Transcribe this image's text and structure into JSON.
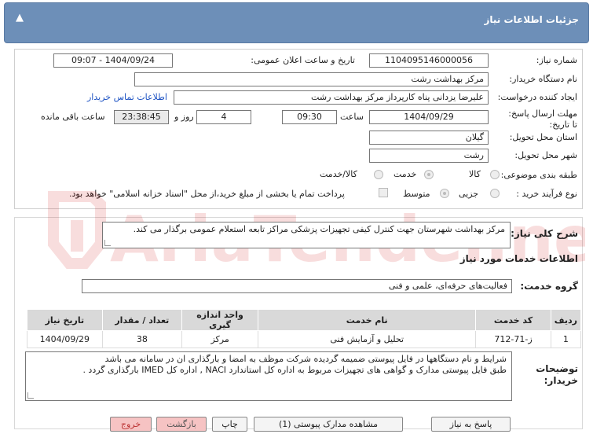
{
  "header": {
    "title": "جزئیات اطلاعات نیاز"
  },
  "form": {
    "need_number_label": "شماره نیاز:",
    "need_number": "1104095146000056",
    "announce_label": "تاریخ و ساعت اعلان عمومی:",
    "announce_value": "1404/09/24 - 09:07",
    "buyer_label": "نام دستگاه خریدار:",
    "buyer_value": "مرکز بهداشت رشت",
    "creator_label": "ایجاد کننده درخواست:",
    "creator_value": "علیرضا یزدانی پناه کارپرداز مرکز بهداشت رشت",
    "contact_link": "اطلاعات تماس خریدار",
    "deadline_label": "مهلت ارسال پاسخ: تا تاریخ:",
    "deadline_date": "1404/09/29",
    "time_label": "ساعت",
    "deadline_time": "09:30",
    "days_value": "4",
    "days_label": "روز و",
    "remaining_time": "23:38:45",
    "remaining_label": "ساعت باقی مانده",
    "province_label": "استان محل تحویل:",
    "province_value": "گیلان",
    "city_label": "شهر محل تحویل:",
    "city_value": "رشت",
    "category_label": "طبقه بندی موضوعی:",
    "category_options": [
      "کالا",
      "خدمت",
      "کالا/خدمت"
    ],
    "process_label": "نوع فرآیند خرید :",
    "process_options": [
      "جزیی",
      "متوسط"
    ],
    "payment_note": "پرداخت تمام یا بخشی از مبلغ خرید،از محل \"اسناد خزانه اسلامی\" خواهد بود."
  },
  "description": {
    "label": "شرح کلی نیاز:",
    "value": "مرکز بهداشت شهرستان جهت کنترل کیفی تجهیزات پزشکی مراکز تابعه استعلام عمومی برگذار می کند."
  },
  "services": {
    "section_title": "اطلاعات خدمات مورد نیاز",
    "group_label": "گروه خدمت:",
    "group_value": "فعالیت‌های حرفه‌ای، علمی و فنی",
    "columns": [
      "ردیف",
      "کد خدمت",
      "نام خدمت",
      "واحد اندازه گیری",
      "تعداد / مقدار",
      "تاریخ نیاز"
    ],
    "rows": [
      [
        "1",
        "ز-71-712",
        "تحلیل و آزمایش فنی",
        "مرکز",
        "38",
        "1404/09/29"
      ]
    ]
  },
  "notes": {
    "label": "توضیحات خریدار:",
    "line1": "شرایط و نام دستگاهها در فایل پیوستی ضمیمه گردیده شرکت موظف به امضا و بارگذاری ان در سامانه می باشد",
    "line2": "طبق فایل پیوستی مدارک و گواهی های تجهیزات مربوط به اداره کل استاندارد NACI , اداره کل IMED بارگذاری گردد ."
  },
  "buttons": {
    "reply": "پاسخ به نیاز",
    "attachments": "مشاهده مدارک پیوستی (1)",
    "print": "چاپ",
    "back": "بازگشت",
    "exit": "خروج"
  },
  "watermark": {
    "text": "AriaTender.net"
  },
  "colors": {
    "header": "#6d8fb8",
    "link": "#1f54c4",
    "exit_button": "#f6c3c3"
  }
}
